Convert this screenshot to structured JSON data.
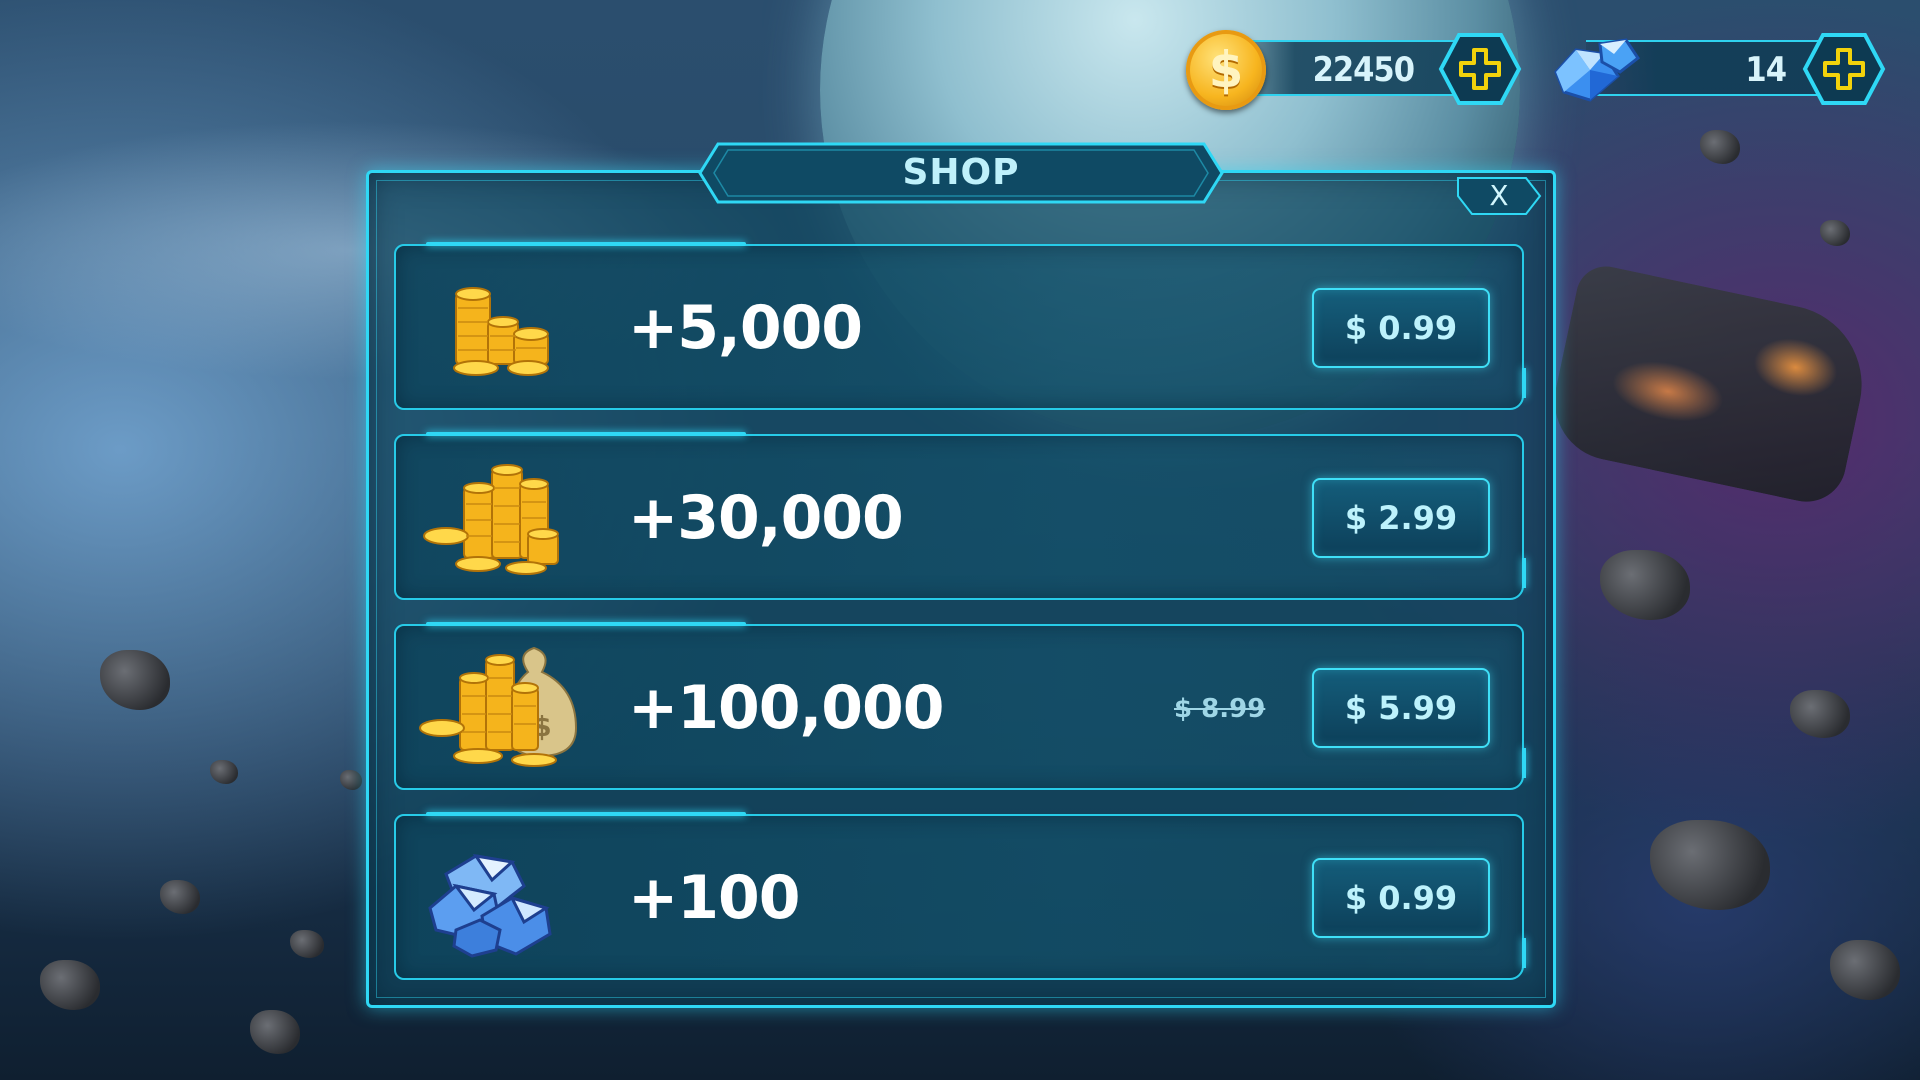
{
  "hud": {
    "coins": {
      "value": "22450",
      "icon": "coin-icon",
      "add_icon": "plus-icon"
    },
    "gems": {
      "value": "14",
      "icon": "gem-icon",
      "add_icon": "plus-icon"
    }
  },
  "shop": {
    "title": "SHOP",
    "close_label": "X",
    "items": [
      {
        "icon": "coin-stack-small-icon",
        "amount": "+5,000",
        "price": "$ 0.99",
        "old_price": ""
      },
      {
        "icon": "coin-stack-medium-icon",
        "amount": "+30,000",
        "price": "$ 2.99",
        "old_price": ""
      },
      {
        "icon": "coin-stack-money-bag-icon",
        "amount": "+100,000",
        "price": "$ 5.99",
        "old_price": "$ 8.99"
      },
      {
        "icon": "gem-pile-icon",
        "amount": "+100",
        "price": "$ 0.99",
        "old_price": ""
      }
    ]
  },
  "colors": {
    "accent": "#2fd8f5",
    "coin_gold": "#f7b51f",
    "plus_yellow": "#f2d20c",
    "text_white": "#ffffff"
  }
}
